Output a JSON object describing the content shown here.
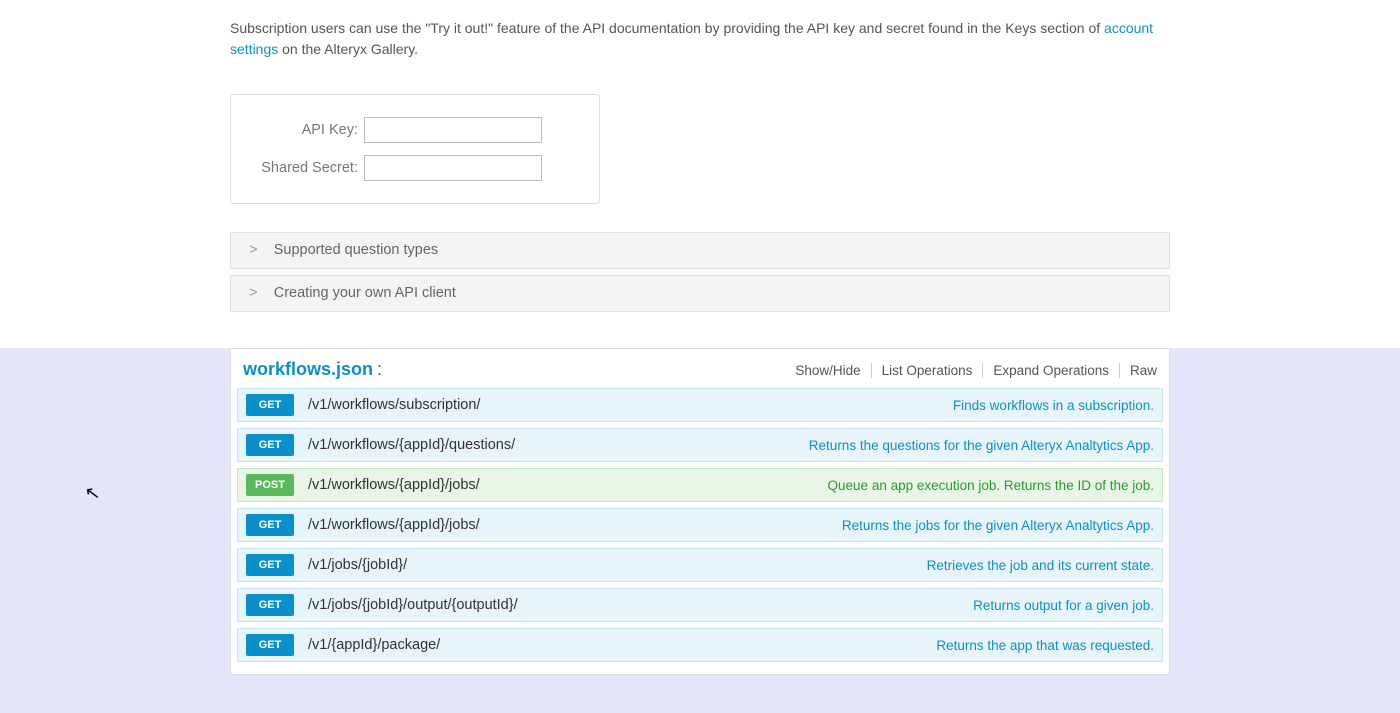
{
  "intro": {
    "text_before": "Subscription users can use the \"Try it out!\" feature of the API documentation by providing the API key and secret found in the Keys section of ",
    "link_text": "account settings",
    "text_after": " on the Alteryx Gallery."
  },
  "creds": {
    "api_key_label": "API Key:",
    "api_key_value": "",
    "secret_label": "Shared Secret:",
    "secret_value": ""
  },
  "accordion": [
    {
      "label": "Supported question types"
    },
    {
      "label": "Creating your own API client"
    }
  ],
  "api": {
    "title": "workflows.json",
    "actions": [
      "Show/Hide",
      "List Operations",
      "Expand Operations",
      "Raw"
    ]
  },
  "endpoints": [
    {
      "method": "GET",
      "path": "/v1/workflows/subscription/",
      "desc": "Finds workflows in a subscription."
    },
    {
      "method": "GET",
      "path": "/v1/workflows/{appId}/questions/",
      "desc": "Returns the questions for the given Alteryx Analtytics App."
    },
    {
      "method": "POST",
      "path": "/v1/workflows/{appId}/jobs/",
      "desc": "Queue an app execution job. Returns the ID of the job."
    },
    {
      "method": "GET",
      "path": "/v1/workflows/{appId}/jobs/",
      "desc": "Returns the jobs for the given Alteryx Analtytics App."
    },
    {
      "method": "GET",
      "path": "/v1/jobs/{jobId}/",
      "desc": "Retrieves the job and its current state."
    },
    {
      "method": "GET",
      "path": "/v1/jobs/{jobId}/output/{outputId}/",
      "desc": "Returns output for a given job."
    },
    {
      "method": "GET",
      "path": "/v1/{appId}/package/",
      "desc": "Returns the app that was requested."
    }
  ]
}
